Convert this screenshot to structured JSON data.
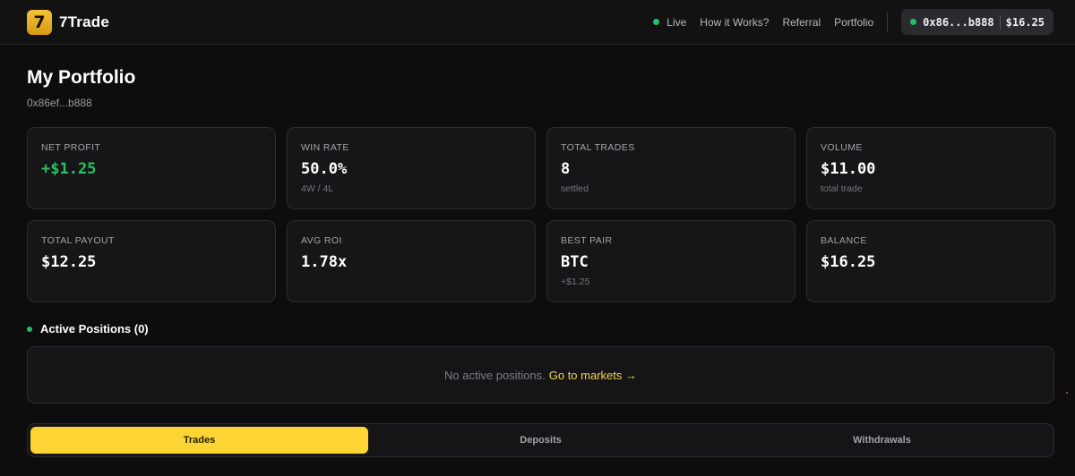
{
  "header": {
    "logo_glyph": "7",
    "brand": "7Trade",
    "nav": {
      "live": "Live",
      "how_it_works": "How it Works?",
      "referral": "Referral",
      "portfolio": "Portfolio"
    },
    "wallet": {
      "address": "0x86...b888",
      "balance": "$16.25"
    }
  },
  "page": {
    "title": "My Portfolio",
    "address": "0x86ef...b888"
  },
  "stats": [
    {
      "label": "NET PROFIT",
      "value": "+$1.25",
      "sub": ""
    },
    {
      "label": "WIN RATE",
      "value": "50.0%",
      "sub": "4W / 4L"
    },
    {
      "label": "TOTAL TRADES",
      "value": "8",
      "sub": "settled"
    },
    {
      "label": "VOLUME",
      "value": "$11.00",
      "sub": "total trade"
    },
    {
      "label": "TOTAL PAYOUT",
      "value": "$12.25",
      "sub": ""
    },
    {
      "label": "AVG ROI",
      "value": "1.78x",
      "sub": ""
    },
    {
      "label": "BEST PAIR",
      "value": "BTC",
      "sub": "+$1.25"
    },
    {
      "label": "BALANCE",
      "value": "$16.25",
      "sub": ""
    }
  ],
  "positions": {
    "heading": "Active Positions (0)",
    "empty_text": "No active positions.",
    "link": "Go to markets →"
  },
  "tabs": [
    {
      "label": "Trades",
      "active": true
    },
    {
      "label": "Deposits",
      "active": false
    },
    {
      "label": "Withdrawals",
      "active": false
    }
  ],
  "colors": {
    "accent": "#fcd535",
    "positive": "#22c55e",
    "live_dot": "#21c064"
  }
}
